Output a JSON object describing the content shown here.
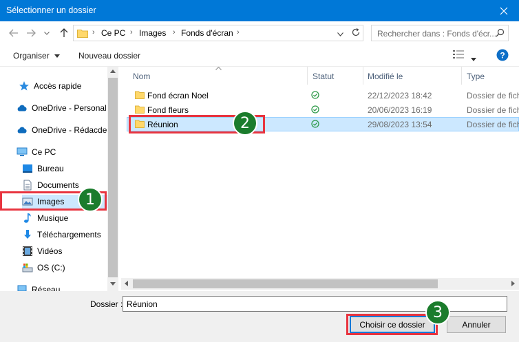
{
  "window": {
    "title": "Sélectionner un dossier"
  },
  "nav": {
    "breadcrumbs": [
      "Ce PC",
      "Images",
      "Fonds d'écran"
    ],
    "search_placeholder": "Rechercher dans : Fonds d'écr..."
  },
  "toolbar": {
    "organize_label": "Organiser",
    "new_folder_label": "Nouveau dossier"
  },
  "sidebar": {
    "items": [
      {
        "label": "Accès rapide",
        "icon": "star-icon"
      },
      {
        "label": "OneDrive - Personal",
        "icon": "cloud-icon"
      },
      {
        "label": "OneDrive - Rédacdes",
        "icon": "cloud-icon"
      },
      {
        "label": "Ce PC",
        "icon": "computer-icon"
      },
      {
        "label": "Bureau",
        "icon": "desktop-icon"
      },
      {
        "label": "Documents",
        "icon": "documents-icon"
      },
      {
        "label": "Images",
        "icon": "pictures-icon",
        "selected": true
      },
      {
        "label": "Musique",
        "icon": "music-icon"
      },
      {
        "label": "Téléchargements",
        "icon": "download-icon"
      },
      {
        "label": "Vidéos",
        "icon": "video-icon"
      },
      {
        "label": "OS (C:)",
        "icon": "drive-icon"
      },
      {
        "label": "Réseau",
        "icon": "network-icon"
      }
    ]
  },
  "columns": {
    "name": "Nom",
    "status": "Statut",
    "modified": "Modifié le",
    "type": "Type"
  },
  "files": [
    {
      "name": "Fond écran Noel",
      "modified": "22/12/2023 18:42",
      "type": "Dossier de fichiers"
    },
    {
      "name": "Fond fleurs",
      "modified": "20/06/2023 16:19",
      "type": "Dossier de fichiers"
    },
    {
      "name": "Réunion",
      "modified": "29/08/2023 13:54",
      "type": "Dossier de fichiers",
      "selected": true
    }
  ],
  "footer": {
    "folder_label": "Dossier :",
    "folder_value": "Réunion",
    "choose_label": "Choisir ce dossier",
    "cancel_label": "Annuler"
  },
  "annotations": [
    "1",
    "2",
    "3"
  ],
  "colors": {
    "titlebar": "#0078d7",
    "selection": "#cce8ff",
    "highlight": "#e8343f",
    "badge": "#1b7c2c",
    "status_ok": "#2f9b4a",
    "folder": "#ffd86b"
  }
}
